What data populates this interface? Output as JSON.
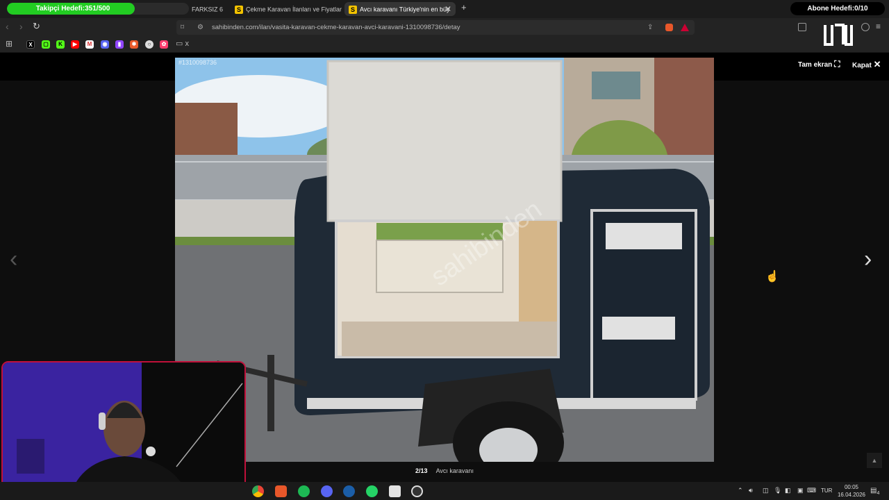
{
  "overlay": {
    "follower_goal": "Takipçi Hedefi:351/500",
    "follower_progress": 0.702,
    "subscriber_goal": "Abone Hedefi:0/10"
  },
  "tabs": [
    {
      "label": "FARKSIZ 6",
      "icon": "tab-icon"
    },
    {
      "label": "Çekme Karavan İlanları ve Fiyatları sa",
      "icon": "s-favicon"
    },
    {
      "label": "Avcı karavanı Türkiye'nin en büy",
      "icon": "s-favicon",
      "active": true
    }
  ],
  "toolbar": {
    "url": "sahibinden.com/ilan/vasita-karavan-cekme-karavan-avci-karavani-1310098736/detay"
  },
  "bookmarks": [
    "x-icon",
    "kick-icon",
    "k-icon",
    "youtube-icon",
    "gmail-icon",
    "discord-icon",
    "twitch-icon",
    "asterisk-icon",
    "circle-icon",
    "gear-icon",
    "folder-icon"
  ],
  "bookmarks_folder_label": "x",
  "viewer": {
    "fullscreen_label": "Tam ekran",
    "close_label": "Kapat",
    "listing_id": "#1310098736",
    "watermark": "sahibinden",
    "counter": "2/13",
    "caption": "Avcı karavanı"
  },
  "taskbar": {
    "apps": [
      "chrome-icon",
      "brave-icon",
      "spotify-icon",
      "discord-icon",
      "steam-icon",
      "whatsapp-icon",
      "file-icon",
      "obs-icon"
    ],
    "language": "TUR",
    "time": "00:05",
    "date": "16.04.2026",
    "notification_count": "4"
  },
  "colors": {
    "accent_green": "#22cc22",
    "webcam_border": "#c0103a",
    "sahibinden_yellow": "#f2c200"
  }
}
